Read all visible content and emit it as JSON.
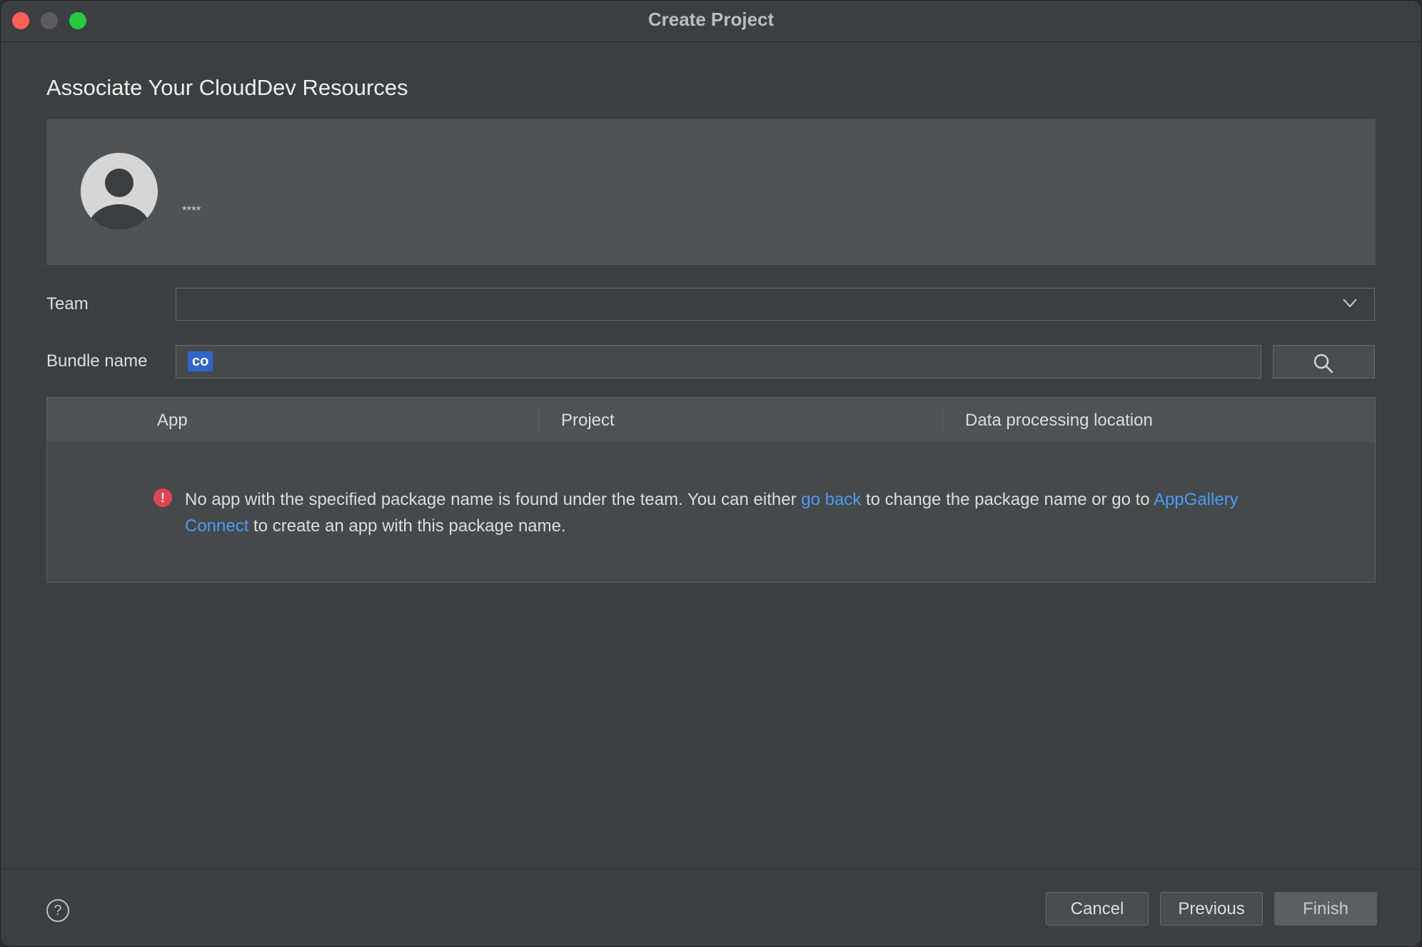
{
  "window": {
    "title": "Create Project"
  },
  "page": {
    "heading": "Associate Your CloudDev Resources"
  },
  "account": {
    "name": "****"
  },
  "team": {
    "label": "Team",
    "value": ""
  },
  "bundle": {
    "label": "Bundle name",
    "value": "co"
  },
  "table": {
    "columns": [
      "App",
      "Project",
      "Data processing location"
    ],
    "message": {
      "part1": "No app with the specified package name is found under the team. You can either ",
      "link1": "go back",
      "part2": " to change the package name or go to ",
      "link2": "AppGallery Connect",
      "part3": " to create an app with this package name."
    }
  },
  "footer": {
    "help": "?",
    "cancel": "Cancel",
    "previous": "Previous",
    "finish": "Finish"
  },
  "colors": {
    "background": "#3c3f41",
    "accent_link": "#4a9cf6",
    "error": "#e0454f",
    "selection": "#2f65ca"
  },
  "icons": [
    "close-icon",
    "minimize-icon",
    "maximize-icon",
    "avatar-icon",
    "chevron-down-icon",
    "search-icon",
    "error-icon",
    "help-icon"
  ]
}
